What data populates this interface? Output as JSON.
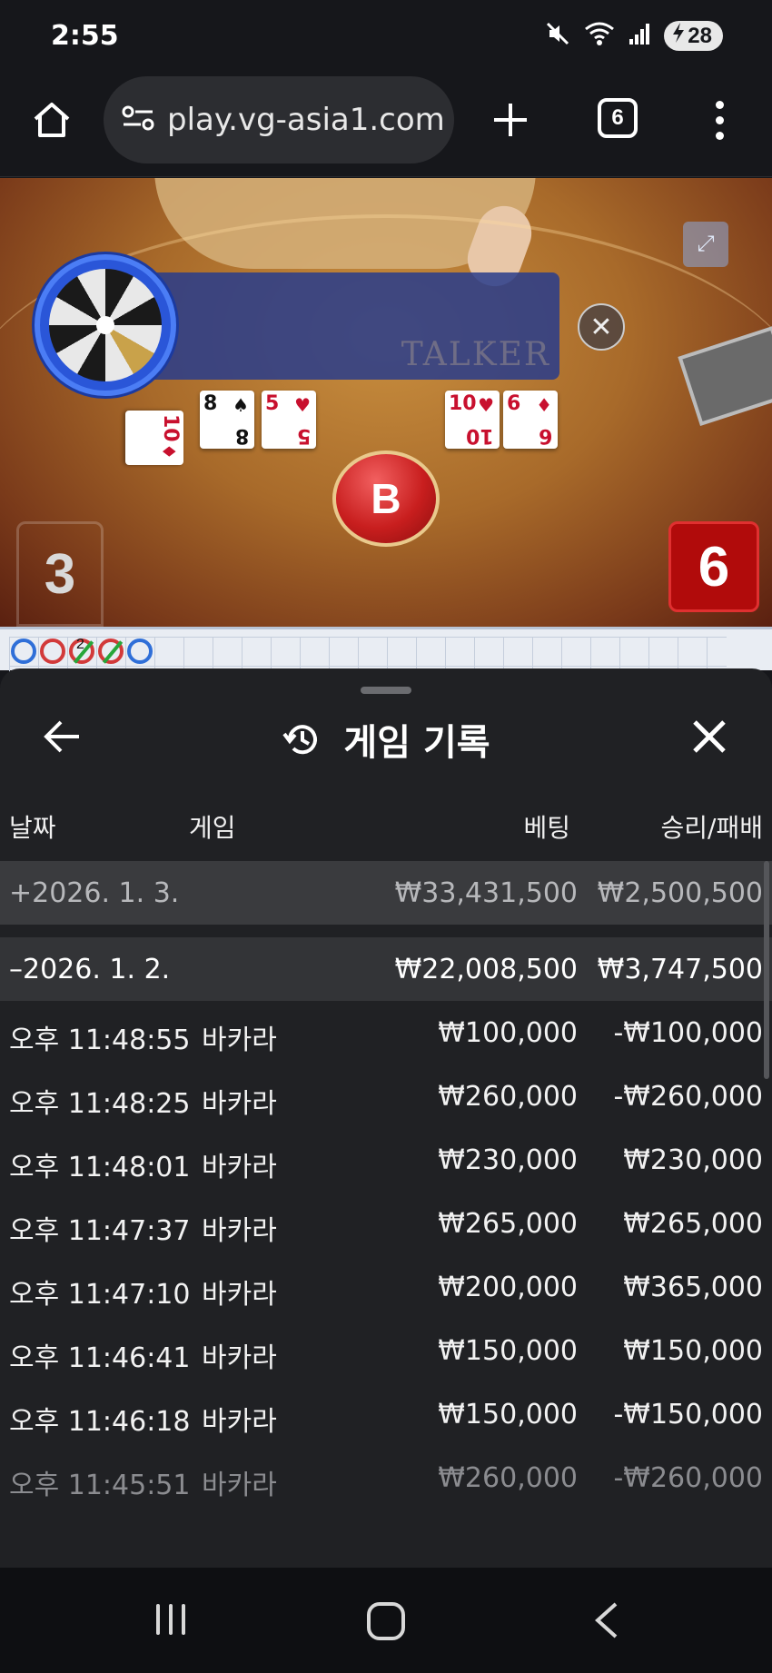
{
  "status_bar": {
    "time": "2:55",
    "battery": "28"
  },
  "browser": {
    "url": "play.vg-asia1.com",
    "tab_count": "6"
  },
  "game_view": {
    "banner_text": "TALKER",
    "player_cards": [
      {
        "rank": "10",
        "suit": "♦",
        "color": "red"
      },
      {
        "rank": "8",
        "suit": "♠",
        "color": "black"
      },
      {
        "rank": "5",
        "suit": "♥",
        "color": "red"
      }
    ],
    "banker_cards": [
      {
        "rank": "10",
        "suit": "♥",
        "color": "red"
      },
      {
        "rank": "6",
        "suit": "♦",
        "color": "red"
      }
    ],
    "result_chip": "B",
    "player_score": "3",
    "banker_score": "6",
    "roadmap_badge": "2"
  },
  "sheet": {
    "title": "게임 기록",
    "columns": {
      "date": "날짜",
      "game": "게임",
      "bet": "베팅",
      "win_loss": "승리/패배"
    },
    "groups": [
      {
        "date": "+2026. 1. 3.",
        "bet": "₩33,431,500",
        "win_loss": "₩2,500,500",
        "expanded": false
      },
      {
        "date": "–2026. 1. 2.",
        "bet": "₩22,008,500",
        "win_loss": "₩3,747,500",
        "expanded": true
      }
    ],
    "records": [
      {
        "time": "오후 11:48:55",
        "game": "바카라",
        "bet": "₩100,000",
        "win_loss": "-₩100,000"
      },
      {
        "time": "오후 11:48:25",
        "game": "바카라",
        "bet": "₩260,000",
        "win_loss": "-₩260,000"
      },
      {
        "time": "오후 11:48:01",
        "game": "바카라",
        "bet": "₩230,000",
        "win_loss": "₩230,000"
      },
      {
        "time": "오후 11:47:37",
        "game": "바카라",
        "bet": "₩265,000",
        "win_loss": "₩265,000"
      },
      {
        "time": "오후 11:47:10",
        "game": "바카라",
        "bet": "₩200,000",
        "win_loss": "₩365,000"
      },
      {
        "time": "오후 11:46:41",
        "game": "바카라",
        "bet": "₩150,000",
        "win_loss": "₩150,000"
      },
      {
        "time": "오후 11:46:18",
        "game": "바카라",
        "bet": "₩150,000",
        "win_loss": "-₩150,000"
      },
      {
        "time": "오후 11:45:51",
        "game": "바카라",
        "bet": "₩260,000",
        "win_loss": "-₩260,000"
      }
    ]
  }
}
